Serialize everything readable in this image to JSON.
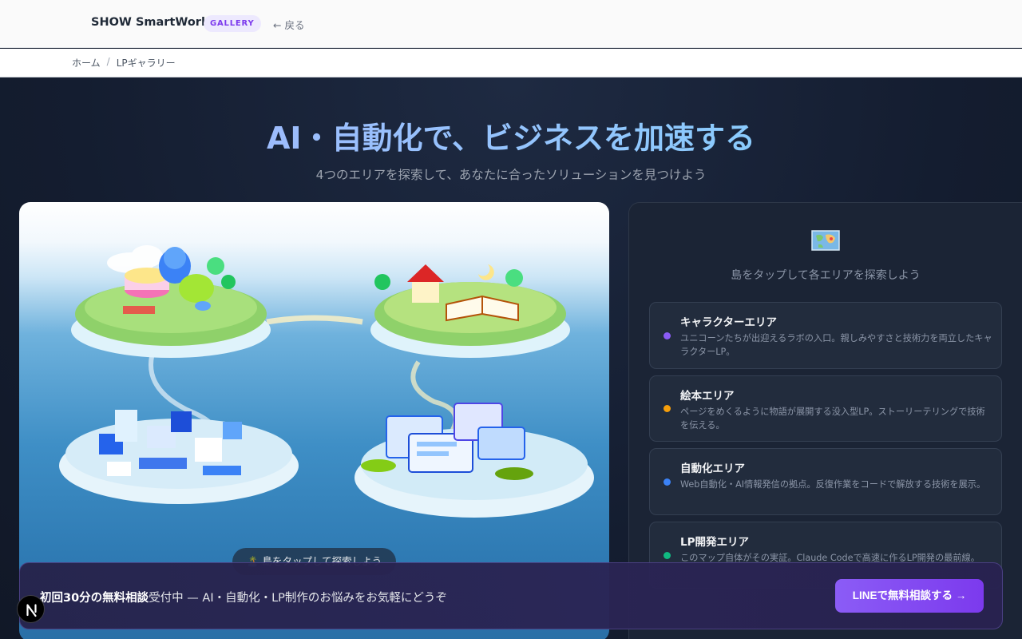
{
  "header": {
    "brand": "SHOW SmartWork",
    "badge": "GALLERY",
    "back_label": "← 戻る"
  },
  "breadcrumb": {
    "home": "ホーム",
    "separator": "/",
    "current": "LPギャラリー"
  },
  "hero": {
    "title": "AI・自動化で、ビジネスを加速する",
    "subtitle": "4つのエリアを探索して、あなたに合ったソリューションを見つけよう"
  },
  "map": {
    "tap_hint": "🏝️ 島をタップして探索しよう"
  },
  "panel": {
    "icon": "world-map-icon",
    "hint": "島をタップして各エリアを探索しよう",
    "areas": [
      {
        "title": "キャラクターエリア",
        "desc": "ユニコーンたちが出迎えるラボの入口。親しみやすさと技術力を両立したキャラクターLP。",
        "color": "#8b5cf6"
      },
      {
        "title": "絵本エリア",
        "desc": "ページをめくるように物語が展開する没入型LP。ストーリーテリングで技術を伝える。",
        "color": "#f59e0b"
      },
      {
        "title": "自動化エリア",
        "desc": "Web自動化・AI情報発信の拠点。反復作業をコードで解放する技術を展示。",
        "color": "#3b82f6"
      },
      {
        "title": "LP開発エリア",
        "desc": "このマップ自体がその実証。Claude Codeで高速に作るLP開発の最前線。",
        "color": "#10b981"
      }
    ]
  },
  "cta": {
    "highlight": "初回30分の無料相談",
    "text": "受付中 — AI・自動化・LP制作のお悩みをお気軽にどうぞ",
    "button": "LINEで無料相談する →"
  },
  "colors": {
    "accent": "#8b5cf6",
    "background": "#131c2e"
  }
}
